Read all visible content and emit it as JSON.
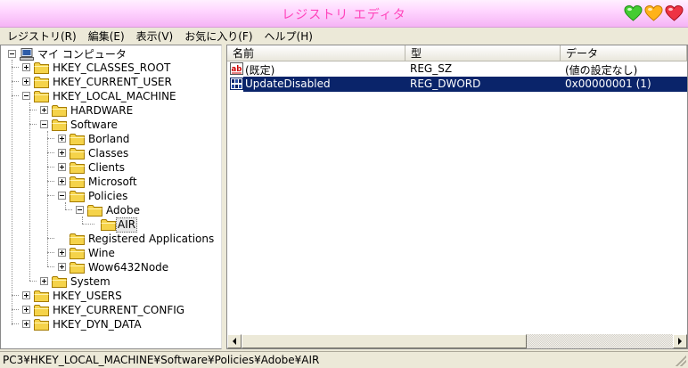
{
  "window": {
    "title": "レジストリ エディタ"
  },
  "menu": [
    "レジストリ(R)",
    "編集(E)",
    "表示(V)",
    "お気に入り(F)",
    "ヘルプ(H)"
  ],
  "tree": {
    "root": "マイ コンピュータ",
    "hkey_classes_root": "HKEY_CLASSES_ROOT",
    "hkey_current_user": "HKEY_CURRENT_USER",
    "hkey_local_machine": "HKEY_LOCAL_MACHINE",
    "hardware": "HARDWARE",
    "software": "Software",
    "borland": "Borland",
    "classes": "Classes",
    "clients": "Clients",
    "microsoft": "Microsoft",
    "policies": "Policies",
    "adobe": "Adobe",
    "air": "AIR",
    "registered_applications": "Registered Applications",
    "wine": "Wine",
    "wow6432node": "Wow6432Node",
    "system": "System",
    "hkey_users": "HKEY_USERS",
    "hkey_current_config": "HKEY_CURRENT_CONFIG",
    "hkey_dyn_data": "HKEY_DYN_DATA"
  },
  "list": {
    "columns": {
      "name": "名前",
      "type": "型",
      "data": "データ"
    },
    "rows": [
      {
        "name": "(既定)",
        "type": "REG_SZ",
        "data": "(値の設定なし)",
        "icon": "string-value-icon"
      },
      {
        "name": "UpdateDisabled",
        "type": "REG_DWORD",
        "data": "0x00000001 (1)",
        "icon": "binary-value-icon"
      }
    ]
  },
  "status": {
    "path": "PC3¥HKEY_LOCAL_MACHINE¥Software¥Policies¥Adobe¥AIR"
  },
  "colors": {
    "title": "#ff44bb",
    "selection": "#0a246a",
    "folder": "#f5d34a"
  }
}
